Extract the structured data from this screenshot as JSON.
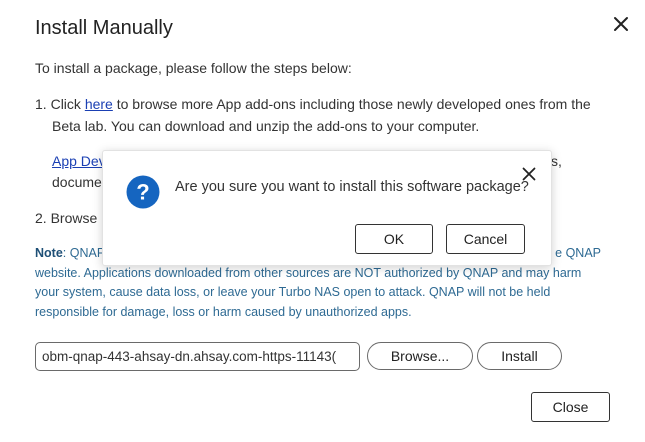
{
  "dialog": {
    "title": "Install Manually",
    "intro": "To install a package, please follow the steps below:",
    "step1": {
      "number": "1.",
      "prefix": "Click ",
      "link": "here",
      "suffix": " to browse more App add-ons including those newly developed ones from the",
      "line2": "Beta lab. You can download and unzip the add-ons to your computer."
    },
    "step1b": {
      "link_partial": "App Dev",
      "line2_partial": "docume",
      "right_partial": "s,"
    },
    "step2": {
      "partial": "2. Browse"
    },
    "note": {
      "label": "Note",
      "line1_start": ": QNAP",
      "line1_end": "e QNAP",
      "line2": "website. Applications downloaded from other sources are NOT authorized by QNAP and may harm",
      "line3": "your system, cause data loss, or leave your Turbo NAS open to attack. QNAP will not be held",
      "line4": "responsible for damage, loss or harm caused by unauthorized apps."
    },
    "file_value": "obm-qnap-443-ahsay-dn.ahsay.com-https-11143(",
    "browse_label": "Browse...",
    "install_label": "Install",
    "close_label": "Close"
  },
  "confirm": {
    "message": "Are you sure you want to install this software package?",
    "ok_label": "OK",
    "cancel_label": "Cancel"
  },
  "colors": {
    "link": "#1a3fb3",
    "note_text": "#2e6a93",
    "question_icon": "#1565c0"
  },
  "icons": {
    "dialog_close": "close-icon",
    "confirm_close": "close-icon",
    "confirm_type": "question-icon"
  }
}
